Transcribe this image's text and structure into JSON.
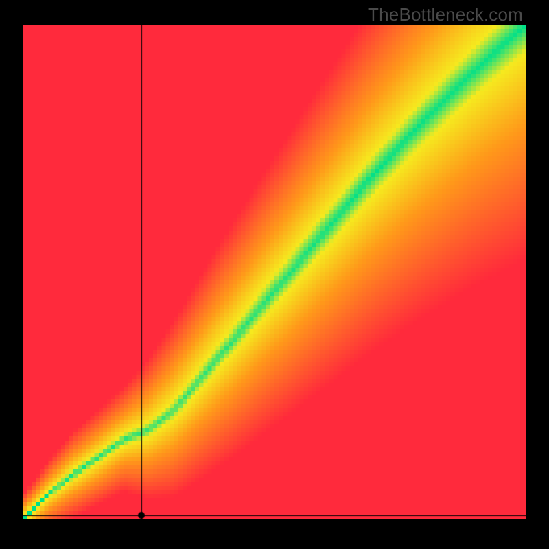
{
  "watermark": "TheBottleneck.com",
  "chart_data": {
    "type": "heatmap",
    "title": "",
    "xlabel": "",
    "ylabel": "",
    "xlim": [
      0,
      1
    ],
    "ylim": [
      0,
      1
    ],
    "description": "2D bottleneck compatibility heat field. Green = balanced (value≈0), red/orange = heavy bottleneck (value→1). Optimal band follows roughly y = x with slight S-curve and widens at higher x. Rendered pixelated ~120×120 cells.",
    "curve": [
      [
        0.0,
        0.0
      ],
      [
        0.05,
        0.05
      ],
      [
        0.1,
        0.09
      ],
      [
        0.15,
        0.125
      ],
      [
        0.2,
        0.16
      ],
      [
        0.22,
        0.168
      ],
      [
        0.25,
        0.18
      ],
      [
        0.3,
        0.22
      ],
      [
        0.35,
        0.28
      ],
      [
        0.4,
        0.34
      ],
      [
        0.45,
        0.4
      ],
      [
        0.5,
        0.46
      ],
      [
        0.55,
        0.52
      ],
      [
        0.6,
        0.58
      ],
      [
        0.65,
        0.64
      ],
      [
        0.7,
        0.7
      ],
      [
        0.75,
        0.755
      ],
      [
        0.8,
        0.81
      ],
      [
        0.85,
        0.86
      ],
      [
        0.9,
        0.91
      ],
      [
        0.95,
        0.955
      ],
      [
        1.0,
        1.0
      ]
    ],
    "band_width": [
      [
        0.0,
        0.01
      ],
      [
        0.1,
        0.018
      ],
      [
        0.2,
        0.022
      ],
      [
        0.25,
        0.03
      ],
      [
        0.3,
        0.038
      ],
      [
        0.4,
        0.05
      ],
      [
        0.5,
        0.06
      ],
      [
        0.6,
        0.07
      ],
      [
        0.7,
        0.08
      ],
      [
        0.8,
        0.09
      ],
      [
        0.9,
        0.1
      ],
      [
        1.0,
        0.11
      ]
    ],
    "marker": {
      "x": 0.235,
      "y": 0.0
    },
    "crosshair": {
      "x": 0.235,
      "y": 0.0
    },
    "colors": {
      "balanced": "#00e08a",
      "near": "#f6ea1f",
      "mid": "#ff9a1a",
      "far": "#ff2a3c"
    }
  }
}
